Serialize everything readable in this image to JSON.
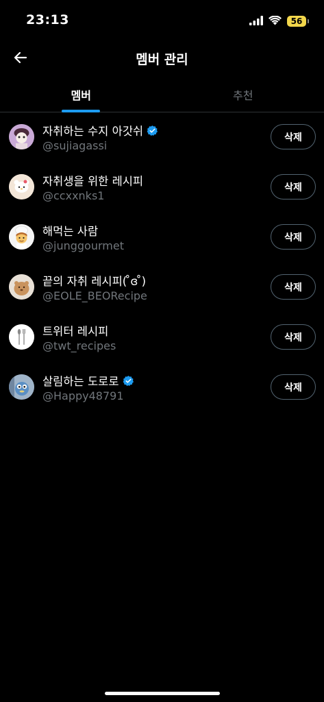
{
  "status": {
    "time": "23:13",
    "battery": "56"
  },
  "header": {
    "title": "멤버 관리",
    "back_icon": "arrow-left-icon"
  },
  "tabs": [
    {
      "label": "멤버",
      "active": true
    },
    {
      "label": "추천",
      "active": false
    }
  ],
  "members": [
    {
      "name": "자취하는 수지 아갓쉬",
      "handle": "@sujiagassi",
      "verified": true,
      "delete_label": "삭제",
      "avatar_color": "#c9a9d6"
    },
    {
      "name": "자취생을 위한 레시피",
      "handle": "@ccxxnks1",
      "verified": false,
      "delete_label": "삭제",
      "avatar_color": "#f3e6d8"
    },
    {
      "name": "해먹는 사람",
      "handle": "@junggourmet",
      "verified": false,
      "delete_label": "삭제",
      "avatar_color": "#f5f5f5"
    },
    {
      "name": "끝의 자취 레시피( ̊ɞ ̊)",
      "handle": "@EOLE_BEORecipe",
      "verified": false,
      "delete_label": "삭제",
      "avatar_color": "#e8e0d6"
    },
    {
      "name": "트위터 레시피",
      "handle": "@twt_recipes",
      "verified": false,
      "delete_label": "삭제",
      "avatar_color": "#ffffff"
    },
    {
      "name": "살림하는 도로로",
      "handle": "@Happy48791",
      "verified": true,
      "delete_label": "삭제",
      "avatar_color": "#9fb4c9"
    }
  ],
  "colors": {
    "accent": "#1d9bf0",
    "battery": "#f2d64b"
  }
}
